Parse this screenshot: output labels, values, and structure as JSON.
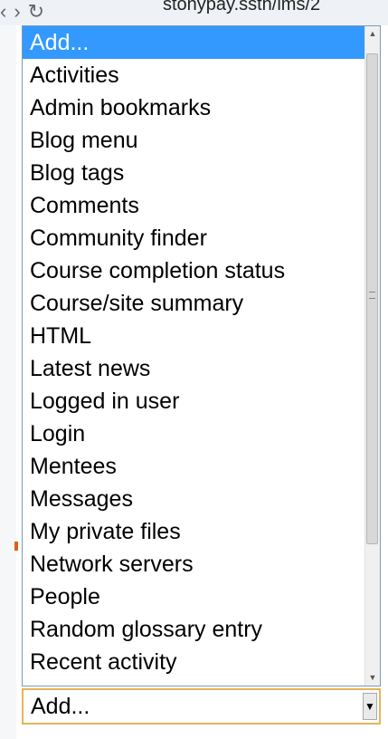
{
  "browser": {
    "url": "stonypay.ssth/lms/2"
  },
  "dropdown": {
    "options": [
      "Add...",
      "Activities",
      "Admin bookmarks",
      "Blog menu",
      "Blog tags",
      "Comments",
      "Community finder",
      "Course completion status",
      "Course/site summary",
      "HTML",
      "Latest news",
      "Logged in user",
      "Login",
      "Mentees",
      "Messages",
      "My private files",
      "Network servers",
      "People",
      "Random glossary entry",
      "Recent activity"
    ],
    "highlighted_option": "Add..."
  },
  "select": {
    "value": "Add..."
  },
  "icons": {
    "scroll_up": "scroll-up-arrow-icon",
    "scroll_down": "scroll-down-arrow-icon",
    "dropdown_arrow": "chevron-down-icon"
  },
  "colors": {
    "highlight": "#3399ff",
    "select_border": "#e6b45a"
  }
}
